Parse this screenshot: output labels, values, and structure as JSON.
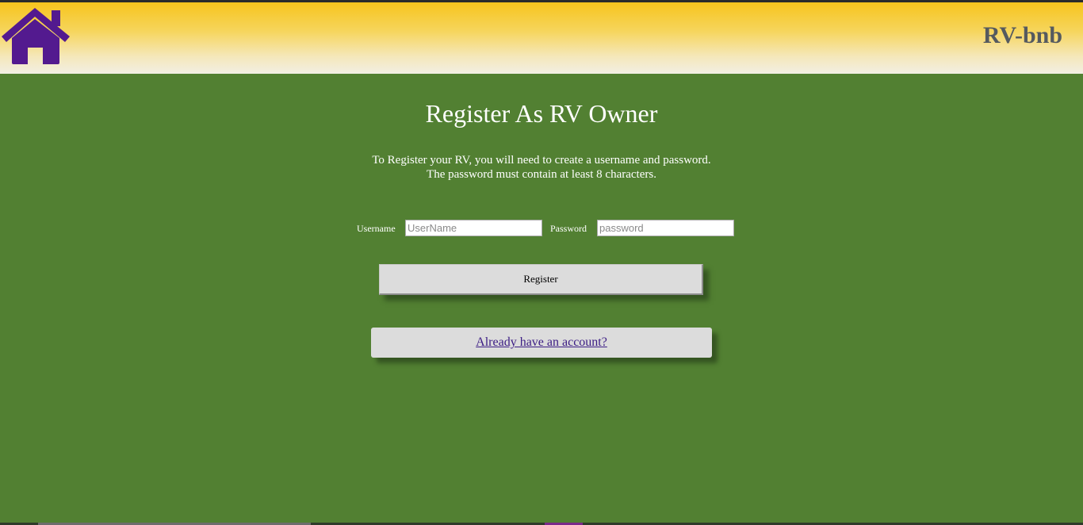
{
  "header": {
    "home_icon": "house-icon",
    "brand": "RV-bnb",
    "colors": {
      "header_top": "#f7c41d",
      "header_bottom": "#f2efe4",
      "brand_text": "#555a5f",
      "home_icon": "#531a8f"
    }
  },
  "main": {
    "title": "Register As RV Owner",
    "instructions_line1": "To Register your RV, you will need to create a username and password.",
    "instructions_line2": "The password must contain at least 8 characters.",
    "background_color": "#528032"
  },
  "form": {
    "username_label": "Username",
    "username_placeholder": "UserName",
    "username_value": "",
    "password_label": "Password",
    "password_placeholder": "password",
    "password_value": "",
    "register_label": "Register"
  },
  "login": {
    "link_text": "Already have an account?"
  }
}
